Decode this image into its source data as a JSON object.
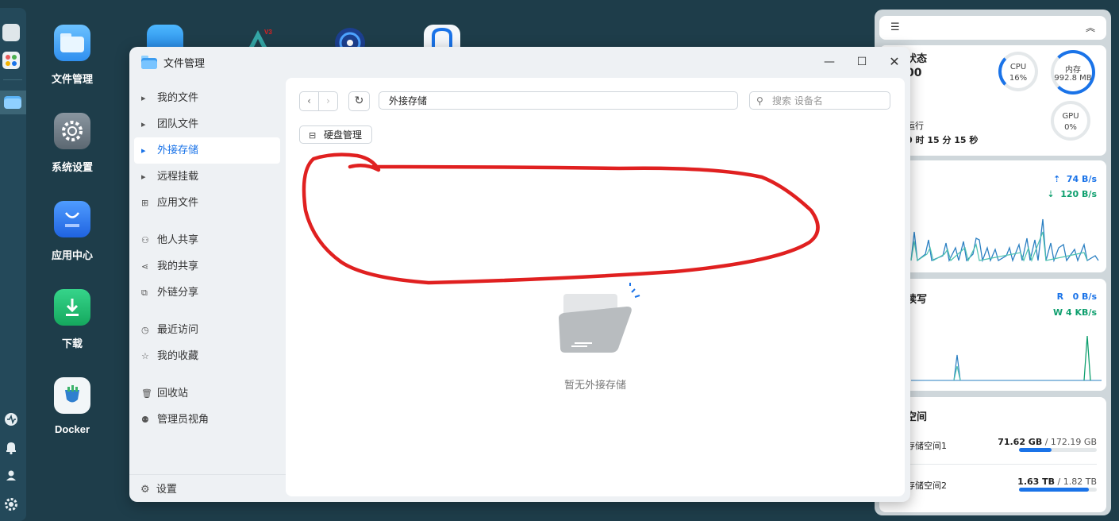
{
  "desktop": {
    "icons": [
      {
        "label": "文件管理"
      },
      {
        "label": "系统设置"
      },
      {
        "label": "应用中心"
      },
      {
        "label": "下载"
      },
      {
        "label": "Docker"
      }
    ]
  },
  "window": {
    "title": "文件管理",
    "sidebar": {
      "items": [
        {
          "label": "我的文件"
        },
        {
          "label": "团队文件"
        },
        {
          "label": "外接存储"
        },
        {
          "label": "远程挂载"
        },
        {
          "label": "应用文件"
        },
        {
          "label": "他人共享"
        },
        {
          "label": "我的共享"
        },
        {
          "label": "外链分享"
        },
        {
          "label": "最近访问"
        },
        {
          "label": "我的收藏"
        },
        {
          "label": "回收站"
        },
        {
          "label": "管理员视角"
        }
      ],
      "settings_label": "设置"
    },
    "toolbar": {
      "path": "外接存储",
      "search_placeholder": "搜索 设备名",
      "disk_manage_label": "硬盘管理"
    },
    "empty_text": "暂无外接存储"
  },
  "widgets": {
    "status": {
      "title_partial": "状态",
      "value_partial": "00",
      "uptime_label_partial": "运行",
      "uptime_value_partial": "0 时 15 分 15 秒",
      "cpu_label": "CPU",
      "cpu_value": "16%",
      "cpu_percent": 16,
      "mem_label": "内存",
      "mem_value": "992.8 MB",
      "mem_percent": 60,
      "gpu_label": "GPU",
      "gpu_value": "0%"
    },
    "network": {
      "upload": "74 B/s",
      "download": "120 B/s"
    },
    "disk_io": {
      "title_partial": "读写",
      "read_label": "R",
      "read_value": "0 B/s",
      "write_label": "W",
      "write_value": "4 KB/s"
    },
    "storage": {
      "title_partial": "空间",
      "pools": [
        {
          "name_partial": "存储空间1",
          "used": "71.62 GB",
          "total": "/ 172.19 GB",
          "fraction": 0.42
        },
        {
          "name_partial": "存储空间2",
          "used": "1.63 TB",
          "total": "/ 1.82 TB",
          "fraction": 0.9
        }
      ]
    }
  },
  "colors": {
    "desktop_bg": "#1e3d4a",
    "accent": "#1a73e8",
    "upload_color": "#1a73e8",
    "download_color": "#0e9f6e",
    "annotation_red": "#e02020"
  }
}
